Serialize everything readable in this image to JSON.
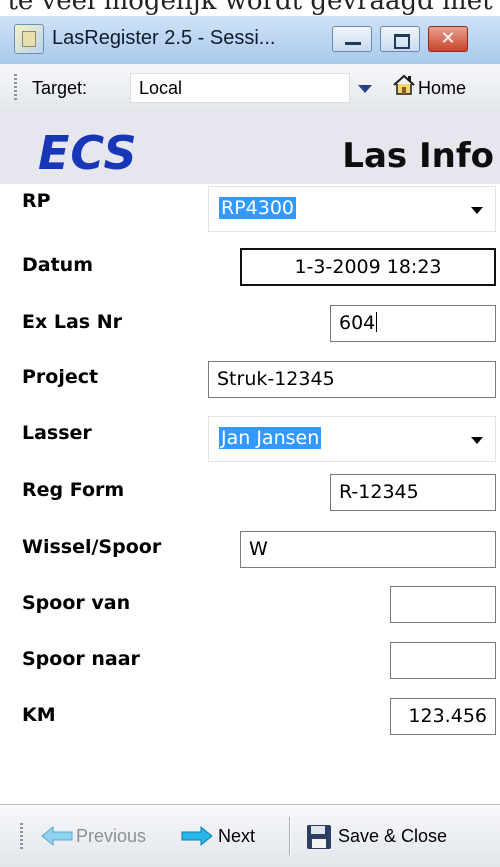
{
  "cropped_caption": "te veel mogelijk wordt gevraagd met",
  "window": {
    "title": "LasRegister 2.5 - Sessi...",
    "min_icon": "minimize-icon",
    "max_icon": "maximize-icon",
    "close_icon": "close-icon"
  },
  "targetbar": {
    "label": "Target:",
    "value": "Local",
    "home_label": "Home"
  },
  "header": {
    "logo": "ECS",
    "title": "Las Info"
  },
  "form": {
    "rp": {
      "label": "RP",
      "value": "RP4300"
    },
    "datum": {
      "label": "Datum",
      "value": "1-3-2009 18:23"
    },
    "ex_las_nr": {
      "label": "Ex Las Nr",
      "value": "604"
    },
    "project": {
      "label": "Project",
      "value": "Struk-12345"
    },
    "lasser": {
      "label": "Lasser",
      "value": "Jan Jansen"
    },
    "reg_form": {
      "label": "Reg Form",
      "value": "R-12345"
    },
    "wissel_spoor": {
      "label": "Wissel/Spoor",
      "value": "W"
    },
    "spoor_van": {
      "label": "Spoor van",
      "value": ""
    },
    "spoor_naar": {
      "label": "Spoor naar",
      "value": ""
    },
    "km": {
      "label": "KM",
      "value": "123.456"
    }
  },
  "toolbar": {
    "previous_label": "Previous",
    "next_label": "Next",
    "save_close_label": "Save & Close"
  },
  "colors": {
    "logo": "#1736b8",
    "selection": "#3399ff",
    "header_bg": "#e6e6ee"
  }
}
